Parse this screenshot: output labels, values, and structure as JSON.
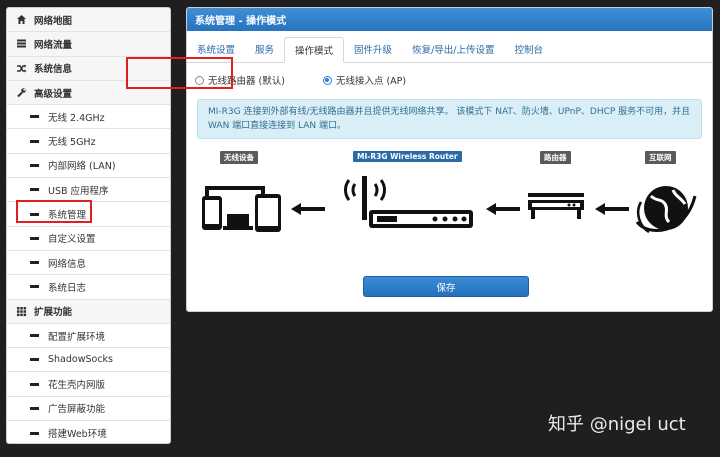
{
  "sidebar": {
    "items": [
      {
        "label": "网络地图",
        "type": "main",
        "icon": "home-icon"
      },
      {
        "label": "网络流量",
        "type": "main",
        "icon": "list-icon"
      },
      {
        "label": "系统信息",
        "type": "main",
        "icon": "shuffle-icon"
      },
      {
        "label": "高级设置",
        "type": "main",
        "icon": "wrench-icon"
      },
      {
        "label": "无线 2.4GHz",
        "type": "sub"
      },
      {
        "label": "无线 5GHz",
        "type": "sub"
      },
      {
        "label": "内部网络 (LAN)",
        "type": "sub"
      },
      {
        "label": "USB 应用程序",
        "type": "sub"
      },
      {
        "label": "系统管理",
        "type": "sub"
      },
      {
        "label": "自定义设置",
        "type": "sub"
      },
      {
        "label": "网络信息",
        "type": "sub"
      },
      {
        "label": "系统日志",
        "type": "sub"
      },
      {
        "label": "扩展功能",
        "type": "main",
        "icon": "grid-icon"
      },
      {
        "label": "配置扩展环境",
        "type": "sub"
      },
      {
        "label": "ShadowSocks",
        "type": "sub"
      },
      {
        "label": "花生壳内网版",
        "type": "sub"
      },
      {
        "label": "广告屏蔽功能",
        "type": "sub"
      },
      {
        "label": "搭建Web环境",
        "type": "sub"
      }
    ]
  },
  "panel": {
    "title": "系统管理 - 操作模式",
    "tabs": [
      "系统设置",
      "服务",
      "操作模式",
      "固件升级",
      "恢复/导出/上传设置",
      "控制台"
    ],
    "active_tab": "操作模式"
  },
  "mode": {
    "option1": "无线路由器 (默认)",
    "option2": "无线接入点 (AP)",
    "selected": "无线接入点 (AP)"
  },
  "info_text": "MI-R3G 连接到外部有线/无线路由器并且提供无线网络共享。 该模式下 NAT、防火墙、UPnP、DHCP 服务不可用，并且 WAN 端口直接连接到 LAN 端口。",
  "diagram": {
    "label_devices": "无线设备",
    "label_router": "MI-R3G Wireless Router",
    "label_upstream": "路由器",
    "label_internet": "互联网"
  },
  "save_label": "保存",
  "watermark": "知乎 @nigel uct",
  "colors": {
    "accent": "#2b7de0",
    "header": "#3079c4",
    "highlight": "#e02020",
    "info_bg": "#daeef8"
  }
}
